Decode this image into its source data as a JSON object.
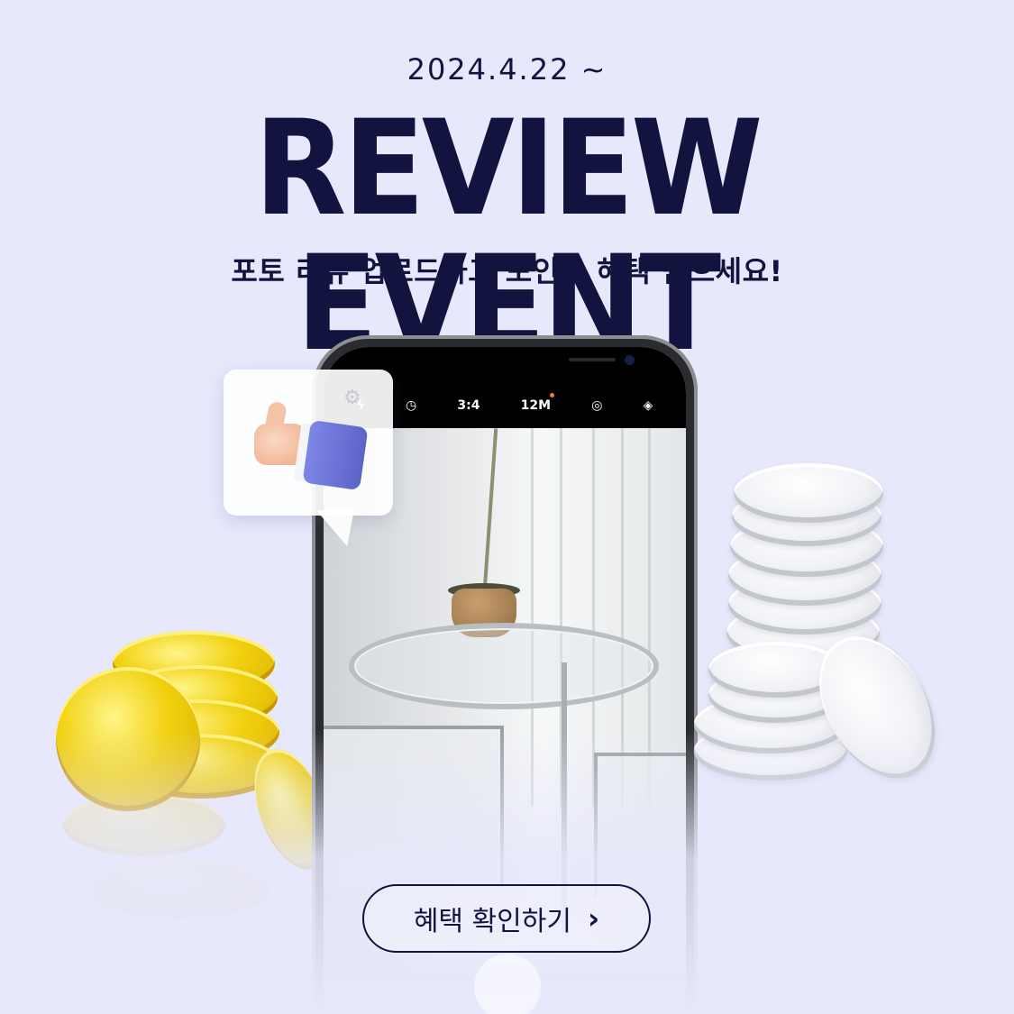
{
  "banner": {
    "date": "2024.4.22 ~",
    "headline": "REVIEW EVENT",
    "subtitle": "포토 리뷰 업로드하고 포인트 혜택 받으세요!"
  },
  "camera_bar": {
    "aspect_ratio": "3:4",
    "resolution": "12M",
    "icons": [
      "flash-off-icon",
      "timer-icon",
      "live-photo-icon",
      "filters-icon"
    ]
  },
  "bubble": {
    "icons": [
      "settings-gear-icon",
      "thumbs-up-icon"
    ]
  },
  "cta": {
    "label": "혜택 확인하기",
    "chevron": "›"
  },
  "colors": {
    "background": "#e7e8fb",
    "navy": "#12143f",
    "gold": "#f1d10f",
    "silver": "#f1f2f6"
  }
}
